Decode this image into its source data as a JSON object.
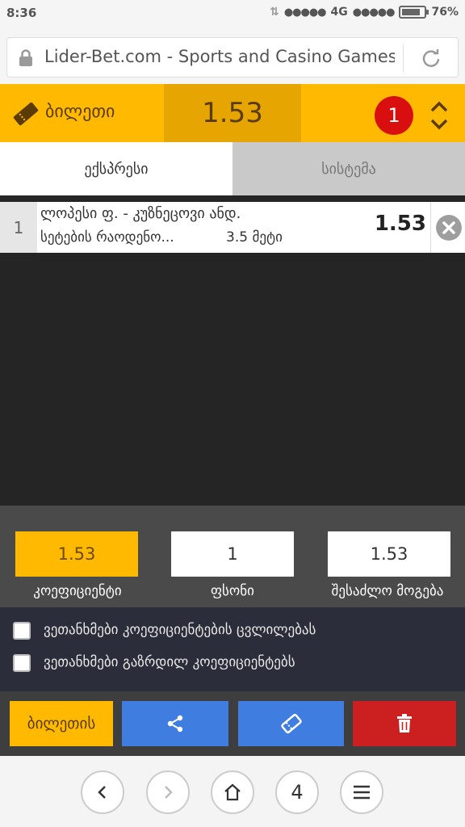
{
  "status": {
    "time": "8:36",
    "signal_dots": "●●●●●",
    "network": "4G",
    "signal_dots2": "●●●●●",
    "battery": "76%"
  },
  "address_bar": {
    "url": "Lider-Bet.com - Sports and Casino Games"
  },
  "ticket": {
    "label": "ბილეთი",
    "total_odds": "1.53",
    "count": "1"
  },
  "tabs": [
    {
      "label": "ექსპრესი"
    },
    {
      "label": "სისტემა"
    }
  ],
  "bet": {
    "index": "1",
    "match": "ლოპესი ფ. - კუზნეცოვი ანდ.",
    "market": "სეტების რაოდენო...",
    "selection": "3.5 მეტი",
    "odds": "1.53"
  },
  "panel": {
    "coef_value": "1.53",
    "coef_label": "კოეფიციენტი",
    "stake_value": "1",
    "stake_label": "ფსონი",
    "win_value": "1.53",
    "win_label": "შესაძლო მოგება"
  },
  "checks": [
    {
      "label": "ვეთანხმები კოეფიციენტების ცვლილებას"
    },
    {
      "label": "ვეთანხმები გაზრდილ კოეფიციენტებს"
    }
  ],
  "actions": {
    "ticket_button": "ბილეთის"
  },
  "nav": {
    "tabs_count": "4"
  },
  "colors": {
    "accent": "#ffb900",
    "blue": "#3f7de0",
    "red": "#cc1f1f",
    "badge": "#d90f0f"
  }
}
